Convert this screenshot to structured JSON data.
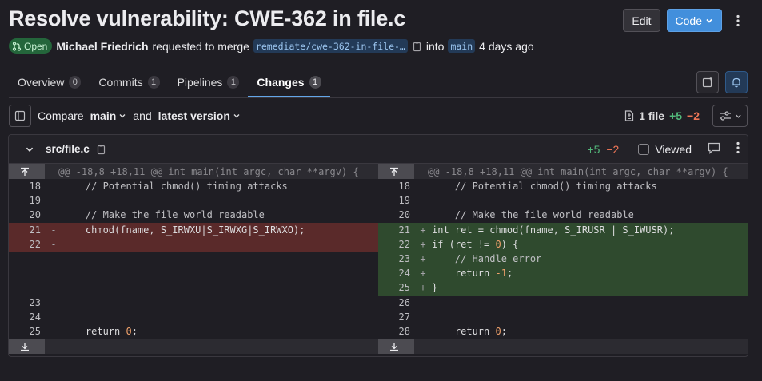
{
  "header": {
    "title": "Resolve vulnerability: CWE-362 in file.c",
    "edit_label": "Edit",
    "code_label": "Code"
  },
  "meta": {
    "status": "Open",
    "author": "Michael Friedrich",
    "action_text": "requested to merge",
    "source_branch": "remediate/cwe-362-in-file-…",
    "into_text": "into",
    "target_branch": "main",
    "time": "4 days ago"
  },
  "tabs": [
    {
      "label": "Overview",
      "count": "0"
    },
    {
      "label": "Commits",
      "count": "1"
    },
    {
      "label": "Pipelines",
      "count": "1"
    },
    {
      "label": "Changes",
      "count": "1"
    }
  ],
  "compare": {
    "compare_label": "Compare",
    "base": "main",
    "and_label": "and",
    "head": "latest version",
    "files_count": "1 file",
    "additions": "+5",
    "deletions": "−2"
  },
  "file": {
    "name": "src/file.c",
    "additions": "+5",
    "deletions": "−2",
    "viewed_label": "Viewed",
    "hunk_header": "@@ -18,8 +18,11 @@ int main(int argc, char **argv) {",
    "left_lines": [
      {
        "num": "18",
        "sign": "",
        "text": "    // Potential chmod() timing attacks",
        "type": "ctx"
      },
      {
        "num": "19",
        "sign": "",
        "text": "",
        "type": "ctx"
      },
      {
        "num": "20",
        "sign": "",
        "text": "    // Make the file world readable",
        "type": "ctx"
      },
      {
        "num": "21",
        "sign": "-",
        "text": "    chmod(fname, S_IRWXU|S_IRWXG|S_IRWXO);",
        "type": "del"
      },
      {
        "num": "22",
        "sign": "-",
        "text": "",
        "type": "del"
      },
      {
        "num": "",
        "sign": "",
        "text": "",
        "type": "empty"
      },
      {
        "num": "",
        "sign": "",
        "text": "",
        "type": "empty"
      },
      {
        "num": "",
        "sign": "",
        "text": "",
        "type": "empty"
      },
      {
        "num": "23",
        "sign": "",
        "text": "",
        "type": "ctx"
      },
      {
        "num": "24",
        "sign": "",
        "text": "",
        "type": "ctx"
      },
      {
        "num": "25",
        "sign": "",
        "text": "    return 0;",
        "type": "ctx"
      }
    ],
    "right_lines": [
      {
        "num": "18",
        "sign": "",
        "text": "    // Potential chmod() timing attacks",
        "type": "ctx"
      },
      {
        "num": "19",
        "sign": "",
        "text": "",
        "type": "ctx"
      },
      {
        "num": "20",
        "sign": "",
        "text": "    // Make the file world readable",
        "type": "ctx"
      },
      {
        "num": "21",
        "sign": "+",
        "text": "int ret = chmod(fname, S_IRUSR | S_IWUSR);",
        "type": "add"
      },
      {
        "num": "22",
        "sign": "+",
        "text": "if (ret != 0) {",
        "type": "add"
      },
      {
        "num": "23",
        "sign": "+",
        "text": "    // Handle error",
        "type": "add"
      },
      {
        "num": "24",
        "sign": "+",
        "text": "    return -1;",
        "type": "add"
      },
      {
        "num": "25",
        "sign": "+",
        "text": "}",
        "type": "add"
      },
      {
        "num": "26",
        "sign": "",
        "text": "",
        "type": "ctx"
      },
      {
        "num": "27",
        "sign": "",
        "text": "",
        "type": "ctx"
      },
      {
        "num": "28",
        "sign": "",
        "text": "    return 0;",
        "type": "ctx"
      }
    ]
  }
}
